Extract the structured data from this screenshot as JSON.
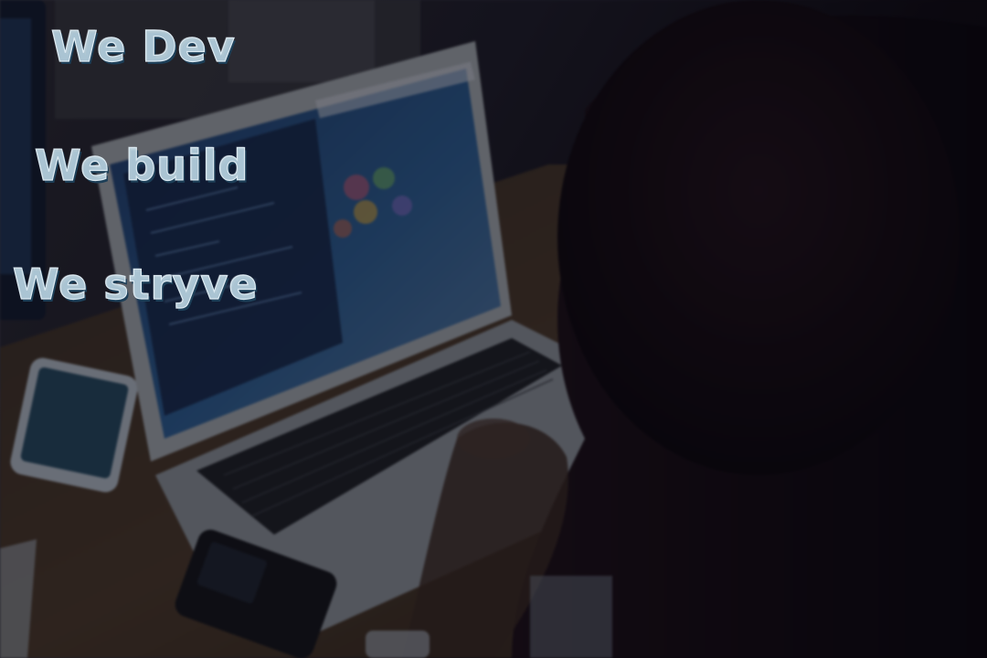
{
  "tagline": {
    "lines": [
      "We Dev",
      "We build",
      "We stryve"
    ]
  },
  "colors": {
    "text_fill": "#bed7e4",
    "text_outline": "#dbe9f1",
    "text_shadow": "#1d3f58",
    "overlay": "#0b0810"
  }
}
